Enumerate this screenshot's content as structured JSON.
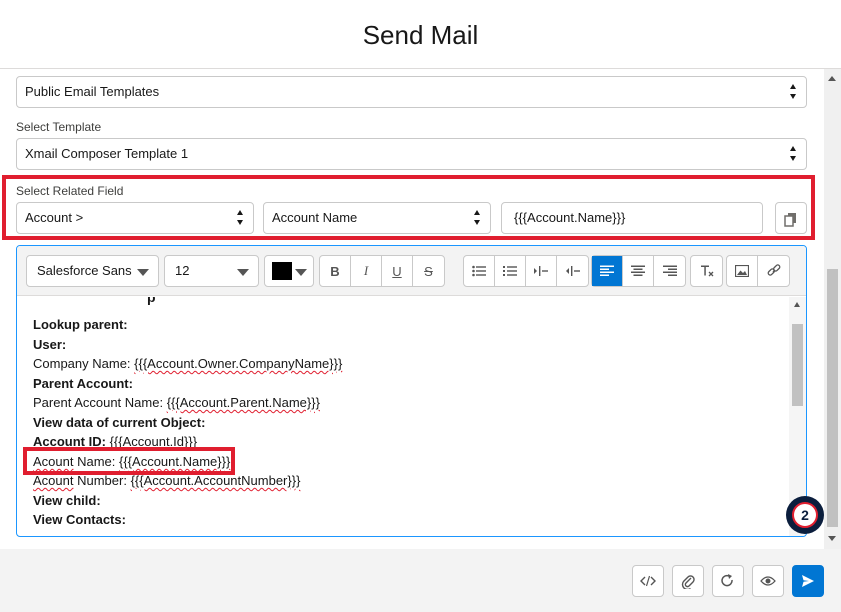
{
  "modal": {
    "title": "Send Mail"
  },
  "template_folder": {
    "value": "Public Email Templates"
  },
  "select_template": {
    "label": "Select Template",
    "value": "Xmail Composer Template 1"
  },
  "related_field": {
    "label": "Select Related Field",
    "object_value": "Account >",
    "field_value": "Account Name",
    "merge_field": "{{{Account.Name}}}"
  },
  "toolbar": {
    "font_family": "Salesforce Sans",
    "font_size": "12",
    "text_color": "#000000",
    "buttons": [
      "bold-icon",
      "italic-icon",
      "underline-icon",
      "strikethrough-icon",
      "bullet-list-icon",
      "numbered-list-icon",
      "indent-icon",
      "outdent-icon",
      "align-left-icon",
      "align-center-icon",
      "align-right-icon",
      "clear-format-icon",
      "image-icon",
      "link-icon"
    ]
  },
  "editor": {
    "lines": {
      "l1": "Lookup parent:",
      "l2": "User:",
      "l3a": "Company Name: ",
      "l3b": "{{{Account.Owner.CompanyName}}}",
      "l4": "Parent Account:",
      "l5a": "Parent Account Name: ",
      "l5b": "{{{Account.Parent.Name}}}",
      "l6": "View data of current Object:",
      "l7a": "Account ID:",
      "l7b": " {{{Account.Id}}}",
      "l8a": "Acount",
      "l8b": " Name: ",
      "l8c": "{{{Account.Name}}}",
      "l9a": "Acount",
      "l9b": " Number: ",
      "l9c": "{{{Account.AccountNumber}}}",
      "l10": "View child:",
      "l11": "View Contacts:"
    }
  },
  "badge": {
    "count": "2"
  },
  "footer": {
    "buttons": [
      "code-icon",
      "attach-icon",
      "redo-icon",
      "preview-icon",
      "send-icon"
    ]
  },
  "colors": {
    "accent": "#0176d3",
    "highlight": "#e01e2f"
  }
}
